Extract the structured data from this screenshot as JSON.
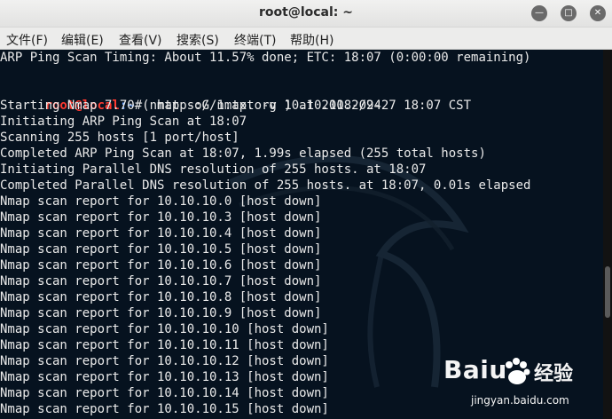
{
  "window": {
    "title": "root@local: ~"
  },
  "menu": [
    "文件(F)",
    "编辑(E)",
    "查看(V)",
    "搜索(S)",
    "终端(T)",
    "帮助(H)"
  ],
  "terminal": {
    "lines": [
      "ARP Ping Scan Timing: About 11.57% done; ETC: 18:07 (0:00:00 remaining)",
      "",
      "",
      "Starting Nmap 7.70 ( https://nmap.org ) at 2018-09-27 18:07 CST",
      "Initiating ARP Ping Scan at 18:07",
      "Scanning 255 hosts [1 port/host]",
      "Completed ARP Ping Scan at 18:07, 1.99s elapsed (255 total hosts)",
      "Initiating Parallel DNS resolution of 255 hosts. at 18:07",
      "Completed Parallel DNS resolution of 255 hosts. at 18:07, 0.01s elapsed",
      "Nmap scan report for 10.10.10.0 [host down]",
      "Nmap scan report for 10.10.10.3 [host down]",
      "Nmap scan report for 10.10.10.4 [host down]",
      "Nmap scan report for 10.10.10.5 [host down]",
      "Nmap scan report for 10.10.10.6 [host down]",
      "Nmap scan report for 10.10.10.7 [host down]",
      "Nmap scan report for 10.10.10.8 [host down]",
      "Nmap scan report for 10.10.10.9 [host down]",
      "Nmap scan report for 10.10.10.10 [host down]",
      "Nmap scan report for 10.10.10.11 [host down]",
      "Nmap scan report for 10.10.10.12 [host down]",
      "Nmap scan report for 10.10.10.13 [host down]",
      "Nmap scan report for 10.10.10.14 [host down]",
      "Nmap scan report for 10.10.10.15 [host down]"
    ],
    "prompt_user_host": "root@local",
    "prompt_path": ":~",
    "prompt_symbol": "#",
    "command": " nmap -oG 1.txt -v 10.10.10.2/24"
  },
  "watermark": {
    "brand": "Bai",
    "brand2": "u",
    "jingyan": "经验",
    "url": "jingyan.baidu.com"
  }
}
